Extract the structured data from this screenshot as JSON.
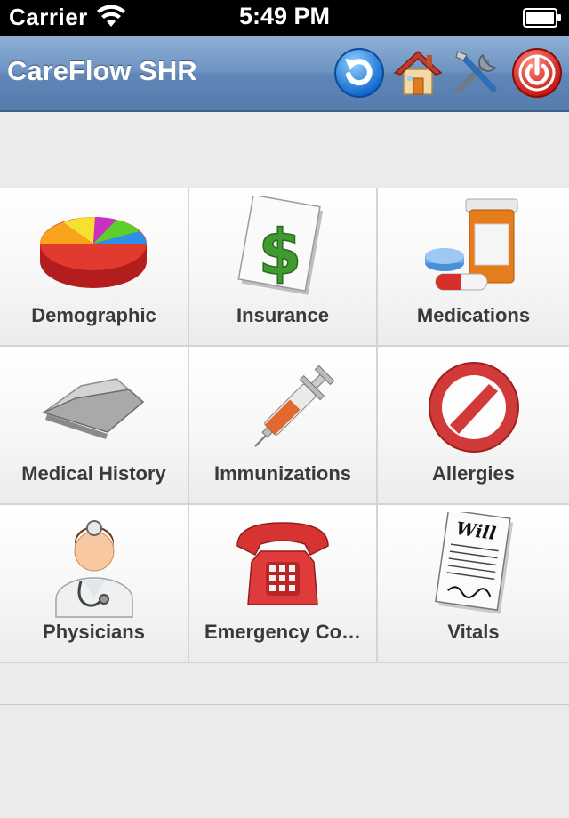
{
  "status_bar": {
    "carrier": "Carrier",
    "time": "5:49 PM"
  },
  "nav_bar": {
    "title": "CareFlow SHR",
    "buttons": [
      {
        "icon": "refresh-icon"
      },
      {
        "icon": "home-icon"
      },
      {
        "icon": "settings-tools-icon"
      },
      {
        "icon": "power-icon"
      }
    ]
  },
  "tiles": [
    {
      "label": "Demographic",
      "icon": "pie-chart-icon"
    },
    {
      "label": "Insurance",
      "icon": "dollar-icon"
    },
    {
      "label": "Medications",
      "icon": "pill-bottle-icon"
    },
    {
      "label": "Medical History",
      "icon": "folder-icon"
    },
    {
      "label": "Immunizations",
      "icon": "syringe-icon"
    },
    {
      "label": "Allergies",
      "icon": "prohibited-icon"
    },
    {
      "label": "Physicians",
      "icon": "doctor-icon"
    },
    {
      "label": "Emergency Co…",
      "icon": "telephone-icon"
    },
    {
      "label": "Vitals",
      "icon": "will-document-icon"
    }
  ],
  "colors": {
    "nav_top": "#8fb0d6",
    "nav_bottom": "#557ca9",
    "background": "#ebebeb",
    "label_text": "#3a3a3a"
  }
}
